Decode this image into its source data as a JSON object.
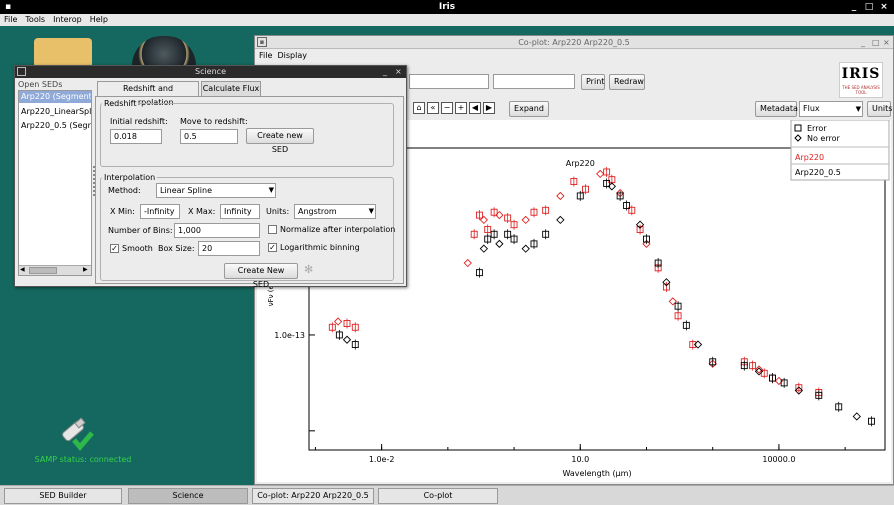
{
  "app": {
    "title": "Iris"
  },
  "menu": [
    "File",
    "Tools",
    "Interop",
    "Help"
  ],
  "samp": {
    "status": "SAMP status: connected"
  },
  "coplot": {
    "title": "Co-plot:  Arp220 Arp220_0.5",
    "menu": [
      "File",
      "Display"
    ],
    "print": "Print",
    "redraw": "Redraw",
    "expand": "Expand",
    "metadata": "Metadata",
    "flux_select": "Flux",
    "units": "Units",
    "logo": "IRIS",
    "logo_sub": "THE SED ANALYSIS TOOL"
  },
  "science": {
    "title": "Science",
    "open_seds_label": "Open SEDs",
    "open_seds": [
      "Arp220 (Segment",
      "Arp220_LinearSpl",
      "Arp220_0.5 (Segr"
    ],
    "tabs": [
      "Redshift and Interpolation",
      "Calculate Flux"
    ],
    "redshift": {
      "legend": "Redshift",
      "initial_label": "Initial redshift:",
      "initial_value": "0.018",
      "move_label": "Move to redshift:",
      "move_value": "0.5",
      "create_button": "Create new SED"
    },
    "interp": {
      "legend": "Interpolation",
      "method_label": "Method:",
      "method_value": "Linear Spline",
      "xmin_label": "X Min:",
      "xmin_value": "-Infinity",
      "xmax_label": "X Max:",
      "xmax_value": "Infinity",
      "units_label": "Units:",
      "units_value": "Angstrom",
      "bins_label": "Number of Bins:",
      "bins_value": "1,000",
      "normalize_label": "Normalize after interpolation",
      "smooth_label": "Smooth",
      "boxsize_label": "Box Size:",
      "boxsize_value": "20",
      "log_label": "Logarithmic binning",
      "create_button": "Create New SED"
    }
  },
  "legend": {
    "error": "Error",
    "no_error": "No error",
    "series": [
      "Arp220",
      "Arp220_0.5"
    ]
  },
  "colors": {
    "series1": "#e02020",
    "series2": "#000000",
    "teal": "#14685f"
  },
  "taskbar": [
    "SED Builder",
    "Science",
    "Co-plot:  Arp220 Arp220_0.5",
    "Co-plot"
  ],
  "chart_data": {
    "type": "scatter",
    "title": "Arp220",
    "xlabel": "Wavelength (µm)",
    "ylabel": "νFν (erg/s/cm2)",
    "xscale": "log",
    "yscale": "log",
    "xlim": [
      0.0008,
      400000
    ],
    "x_ticks": [
      "1.0e-2",
      "10.0",
      "10000.0"
    ],
    "y_ticks": [
      "1.0e-13"
    ],
    "legend_position": "top-right",
    "series": [
      {
        "name": "Arp220",
        "color": "#e02020",
        "points": [
          [
            0.0018,
            -12.92
          ],
          [
            0.0022,
            -12.86
          ],
          [
            0.003,
            -12.88
          ],
          [
            0.004,
            -12.92
          ],
          [
            0.2,
            -12.25
          ],
          [
            0.25,
            -11.95
          ],
          [
            0.3,
            -11.75
          ],
          [
            0.35,
            -11.8
          ],
          [
            0.4,
            -11.9
          ],
          [
            0.5,
            -11.72
          ],
          [
            0.6,
            -11.75
          ],
          [
            0.8,
            -11.78
          ],
          [
            1.0,
            -11.85
          ],
          [
            1.5,
            -11.8
          ],
          [
            2.0,
            -11.72
          ],
          [
            3.0,
            -11.7
          ],
          [
            5.0,
            -11.55
          ],
          [
            8.0,
            -11.4
          ],
          [
            12.0,
            -11.48
          ],
          [
            20,
            -11.32
          ],
          [
            25,
            -11.3
          ],
          [
            30,
            -11.38
          ],
          [
            40,
            -11.52
          ],
          [
            60,
            -11.7
          ],
          [
            80,
            -11.9
          ],
          [
            100,
            -12.05
          ],
          [
            150,
            -12.3
          ],
          [
            200,
            -12.5
          ],
          [
            250,
            -12.65
          ],
          [
            300,
            -12.8
          ],
          [
            500,
            -13.1
          ],
          [
            1000,
            -13.3
          ],
          [
            3000,
            -13.28
          ],
          [
            4000,
            -13.32
          ],
          [
            5000,
            -13.36
          ],
          [
            6000,
            -13.4
          ],
          [
            8000,
            -13.45
          ],
          [
            10000,
            -13.48
          ],
          [
            20000,
            -13.55
          ],
          [
            40000,
            -13.6
          ]
        ]
      },
      {
        "name": "Arp220_0.5",
        "color": "#000000",
        "points": [
          [
            0.0023,
            -13.0
          ],
          [
            0.003,
            -13.05
          ],
          [
            0.004,
            -13.1
          ],
          [
            0.3,
            -12.35
          ],
          [
            0.35,
            -12.1
          ],
          [
            0.4,
            -12.0
          ],
          [
            0.5,
            -11.95
          ],
          [
            0.6,
            -12.05
          ],
          [
            0.8,
            -11.95
          ],
          [
            1.0,
            -12.0
          ],
          [
            1.5,
            -12.1
          ],
          [
            2.0,
            -12.05
          ],
          [
            3.0,
            -11.95
          ],
          [
            5,
            -11.8
          ],
          [
            10,
            -11.55
          ],
          [
            25,
            -11.42
          ],
          [
            30,
            -11.45
          ],
          [
            40,
            -11.55
          ],
          [
            50,
            -11.65
          ],
          [
            80,
            -11.85
          ],
          [
            100,
            -12.0
          ],
          [
            150,
            -12.25
          ],
          [
            200,
            -12.45
          ],
          [
            300,
            -12.7
          ],
          [
            400,
            -12.9
          ],
          [
            600,
            -13.1
          ],
          [
            1000,
            -13.28
          ],
          [
            3000,
            -13.32
          ],
          [
            5000,
            -13.38
          ],
          [
            8000,
            -13.45
          ],
          [
            12000,
            -13.5
          ],
          [
            20000,
            -13.58
          ],
          [
            40000,
            -13.63
          ],
          [
            80000,
            -13.75
          ],
          [
            150000,
            -13.85
          ],
          [
            250000,
            -13.9
          ]
        ]
      }
    ]
  }
}
